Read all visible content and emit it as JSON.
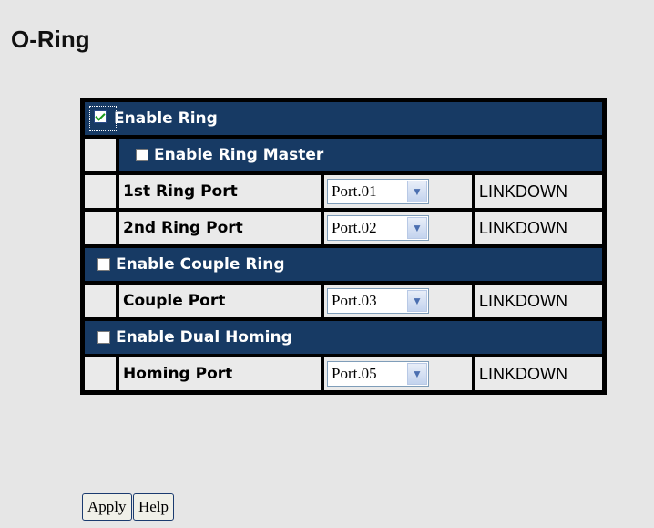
{
  "page": {
    "title": "O-Ring"
  },
  "ring": {
    "enable_ring_label": "Enable Ring",
    "enable_ring_checked": true,
    "enable_master_label": "Enable Ring Master",
    "enable_master_checked": false,
    "port1_label": "1st Ring Port",
    "port1_value": "Port.01",
    "port1_status": "LINKDOWN",
    "port2_label": "2nd Ring Port",
    "port2_value": "Port.02",
    "port2_status": "LINKDOWN"
  },
  "couple": {
    "enable_label": "Enable Couple Ring",
    "enable_checked": false,
    "port_label": "Couple Port",
    "port_value": "Port.03",
    "port_status": "LINKDOWN"
  },
  "dual": {
    "enable_label": "Enable Dual Homing",
    "enable_checked": false,
    "port_label": "Homing Port",
    "port_value": "Port.05",
    "port_status": "LINKDOWN"
  },
  "buttons": {
    "apply": "Apply",
    "help": "Help"
  },
  "colors": {
    "header_bg": "#173a64",
    "page_bg": "#e6e6e6"
  },
  "icons": {
    "dropdown": "chevron-down-icon",
    "checkbox": "checkbox-icon"
  }
}
